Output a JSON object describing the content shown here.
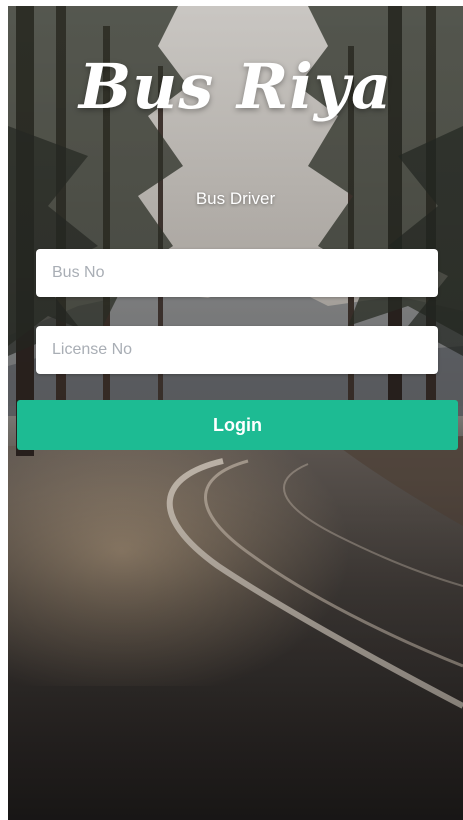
{
  "app": {
    "title": "Bus Riya",
    "subtitle": "Bus Driver"
  },
  "form": {
    "bus_no": {
      "placeholder": "Bus No",
      "value": ""
    },
    "license_no": {
      "placeholder": "License No",
      "value": ""
    },
    "login_label": "Login"
  },
  "colors": {
    "accent": "#1dbb93",
    "input_background": "#ffffff",
    "placeholder_text": "#a9aeb5"
  }
}
